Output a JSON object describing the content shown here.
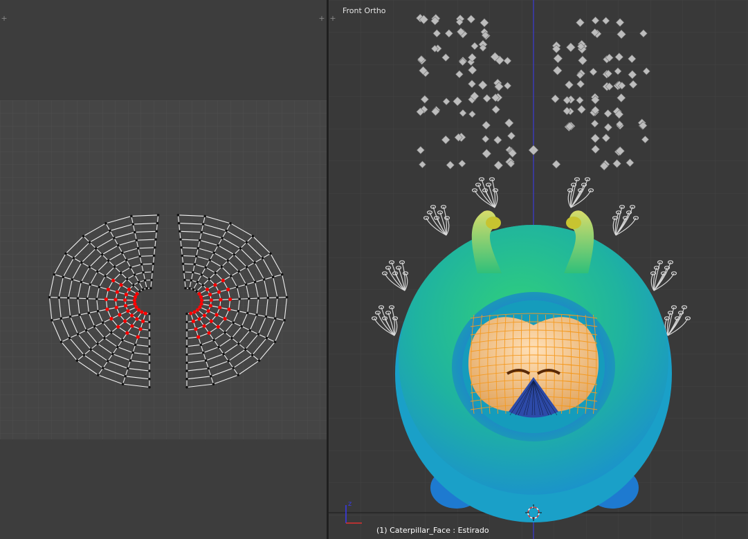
{
  "uv_editor": {
    "corner_icon": "+",
    "colors": {
      "background": "#3d3d3d",
      "image_area": "#444444",
      "grid": "#505050",
      "edge": "#ffffff",
      "vertex": "#111111",
      "selected_vertex": "#ff0000"
    }
  },
  "viewport": {
    "view_name": "Front Ortho",
    "object_info": "(1) Caterpillar_Face : Estirado",
    "corner_icon": "+",
    "axis_labels": {
      "z": "z"
    },
    "colors": {
      "background": "#393939",
      "z_axis": "#3a3ae8",
      "x_axis": "#2a2a2a",
      "body": "#1fc08a",
      "face": "#f0bd7a",
      "wire": "#f59a20"
    }
  }
}
